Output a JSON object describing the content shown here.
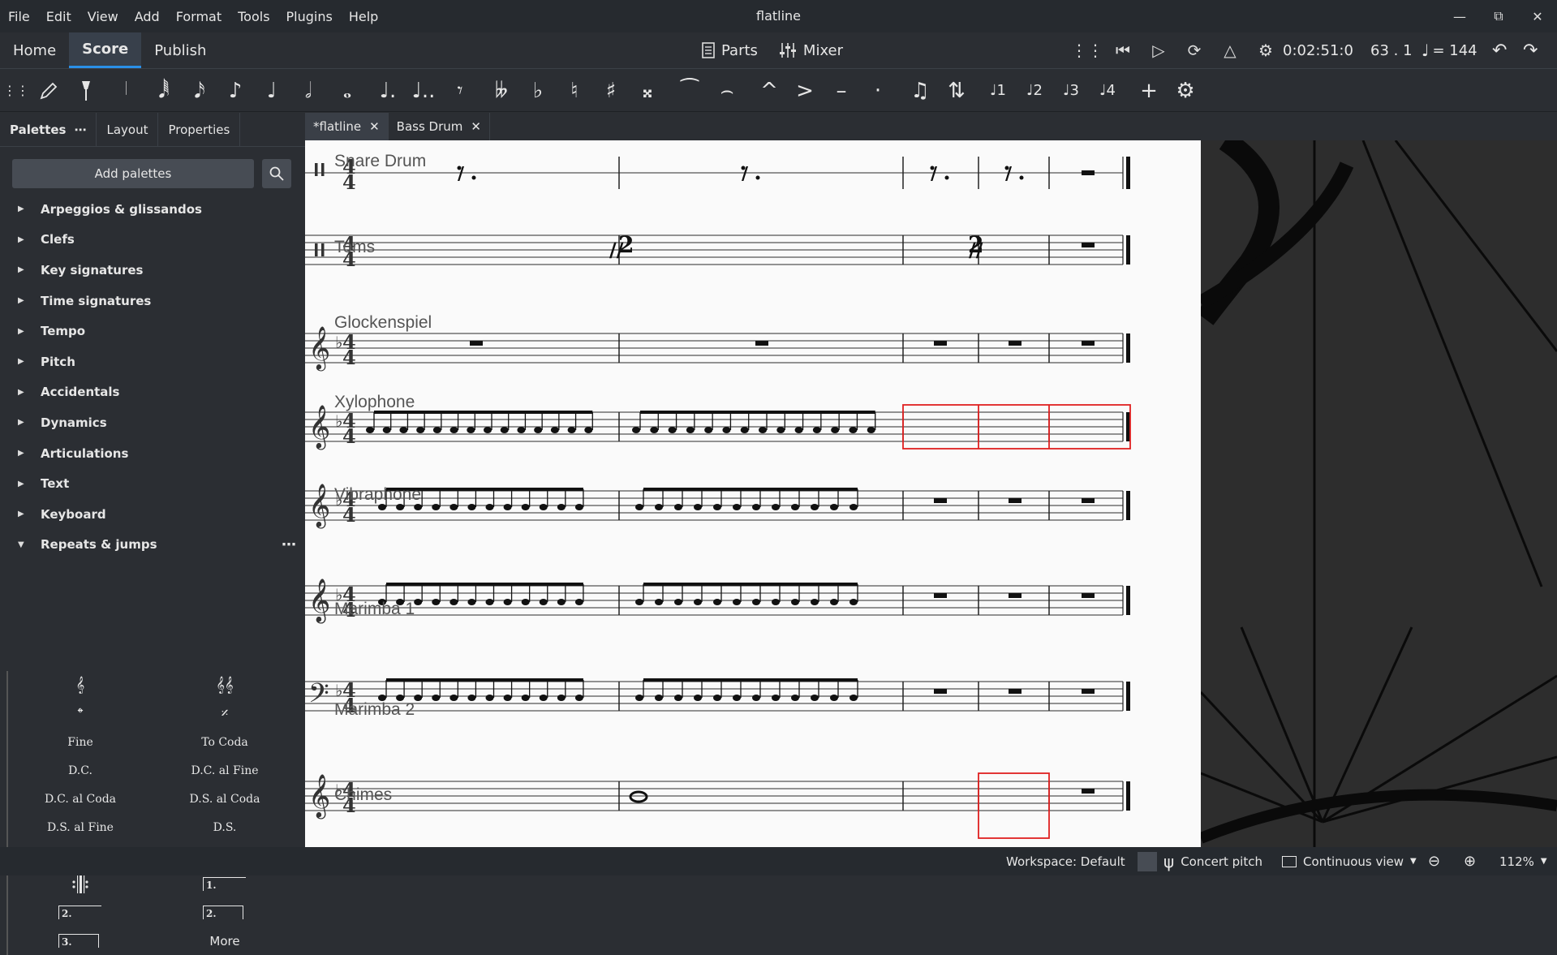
{
  "window": {
    "title": "flatline"
  },
  "menu": [
    "File",
    "Edit",
    "View",
    "Add",
    "Format",
    "Tools",
    "Plugins",
    "Help"
  ],
  "main_tabs": {
    "home": "Home",
    "score": "Score",
    "publish": "Publish"
  },
  "center": {
    "parts": "Parts",
    "mixer": "Mixer"
  },
  "playback": {
    "time": "0:02:51:0",
    "position": "63 . 1",
    "tempo": "= 144"
  },
  "left_panel": {
    "tabs": {
      "palettes": "Palettes",
      "layout": "Layout",
      "properties": "Properties"
    },
    "add_palettes": "Add palettes",
    "palettes": [
      "Arpeggios & glissandos",
      "Clefs",
      "Key signatures",
      "Time signatures",
      "Tempo",
      "Pitch",
      "Accidentals",
      "Dynamics",
      "Articulations",
      "Text",
      "Keyboard",
      "Repeats & jumps"
    ],
    "repeats_cells": {
      "fine": "Fine",
      "to_coda": "To Coda",
      "dc": "D.C.",
      "dc_al_fine": "D.C. al Fine",
      "dc_al_coda": "D.C. al Coda",
      "ds_al_coda": "D.S. al Coda",
      "ds_al_fine": "D.S. al Fine",
      "ds": "D.S.",
      "volta1": "1.",
      "volta2a": "2.",
      "volta2b": "2.",
      "volta3": "3.",
      "more": "More"
    }
  },
  "doc_tabs": {
    "flatline": "*flatline",
    "bass_drum": "Bass Drum"
  },
  "score": {
    "staves": [
      "Snare Drum",
      "Toms",
      "Glockenspiel",
      "Xylophone",
      "Vibraphone",
      "Marimba 1",
      "Marimba 2",
      "Chimes"
    ],
    "repeat_count_1": "2",
    "repeat_count_2": "2",
    "time_sig_top": "4",
    "time_sig_bottom": "4"
  },
  "status": {
    "workspace": "Workspace: Default",
    "concert_pitch": "Concert pitch",
    "view_mode": "Continuous view",
    "zoom": "112%"
  },
  "colors": {
    "accent": "#2a90e8",
    "selection": "#e02020",
    "page": "#fafafa"
  }
}
